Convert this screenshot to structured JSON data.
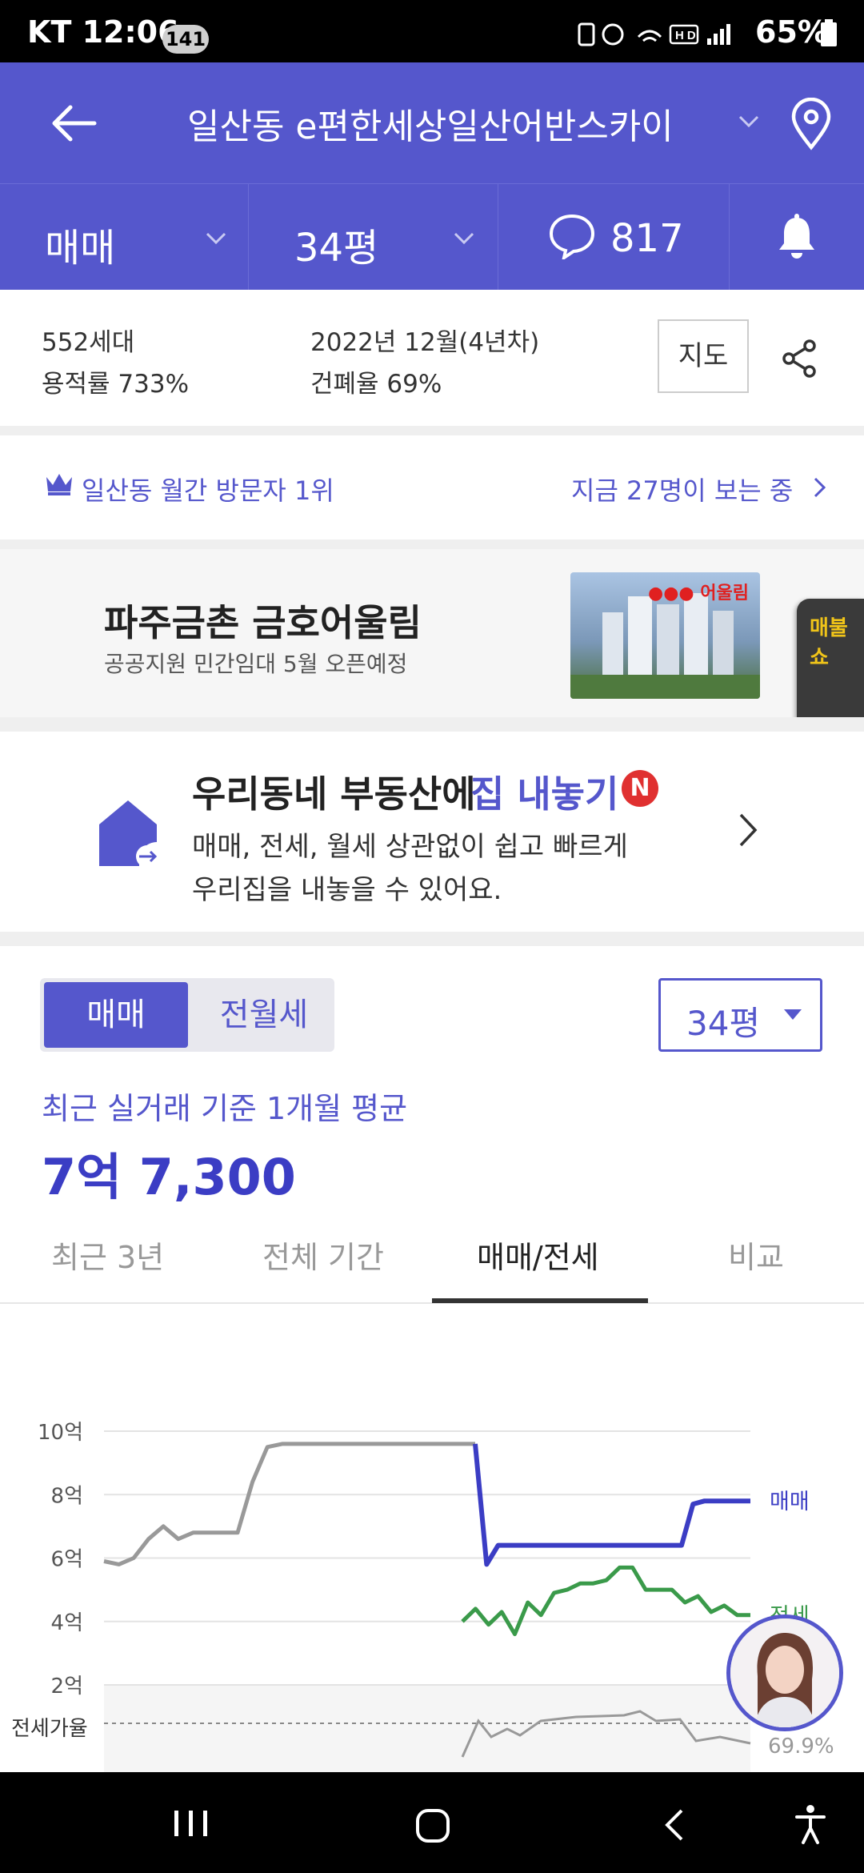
{
  "status": {
    "carrier": "KT",
    "time": "12:06",
    "notif_count": "141",
    "battery": "65%",
    "net_icons": "HD"
  },
  "header": {
    "title": "일산동 e편한세상일산어반스카이"
  },
  "subheader": {
    "trade_type": "매매",
    "size": "34평",
    "comment_count": "817"
  },
  "info": {
    "households": "552세대",
    "far": "용적률 733%",
    "built": "2022년 12월(4년차)",
    "bcr": "건폐율 69%",
    "map_button": "지도"
  },
  "rank": {
    "label": "일산동 월간 방문자 1위",
    "viewers": "지금 27명이 보는 중"
  },
  "ad": {
    "title": "파주금촌 금호어울림",
    "subtitle": "공공지원 민간임대 5월 오픈예정",
    "brand": "어울림",
    "side_banner": "매불쇼"
  },
  "promo": {
    "title_a": "우리동네 부동산에",
    "title_b": "집 내놓기",
    "badge": "N",
    "desc1": "매매, 전세, 월세 상관없이 쉽고 빠르게",
    "desc2": "우리집을 내놓을 수 있어요."
  },
  "toggle": {
    "on": "매매",
    "off": "전월세"
  },
  "size_select": {
    "value": "34평"
  },
  "avg": {
    "caption": "최근 실거래 기준 1개월 평균",
    "price": "7억 7,300"
  },
  "tabs": [
    "최근 3년",
    "전체 기간",
    "매매/전세",
    "비교"
  ],
  "colors": {
    "primary": "#5557cc",
    "sale": "#3b3dc4",
    "jeonse": "#3a9a4a",
    "history": "#999999"
  },
  "chart_data": {
    "type": "line",
    "y_ticks": [
      "10억",
      "8억",
      "6억",
      "4억",
      "2억"
    ],
    "ylim": [
      2,
      10
    ],
    "ratio_label": "전세가율",
    "ratio_value": "69.9%",
    "series": [
      {
        "name": "",
        "values": [
          5.9,
          5.8,
          6.0,
          6.6,
          7.0,
          6.6,
          6.8,
          6.8,
          6.8,
          6.8,
          8.4,
          9.5,
          9.6,
          9.6,
          9.6,
          9.6,
          9.6,
          9.6,
          9.6,
          9.6,
          9.6,
          9.6,
          9.6,
          9.6,
          9.6,
          9.6
        ]
      },
      {
        "name": "매매",
        "values": [
          9.6,
          5.8,
          6.4,
          6.4,
          6.4,
          6.4,
          6.4,
          6.4,
          6.4,
          6.4,
          6.4,
          6.4,
          6.4,
          6.4,
          6.4,
          6.4,
          6.4,
          6.4,
          6.4,
          7.7,
          7.8,
          7.8,
          7.8,
          7.8,
          7.8
        ]
      },
      {
        "name": "전세",
        "values": [
          4.0,
          4.4,
          3.9,
          4.3,
          3.6,
          4.6,
          4.2,
          4.9,
          5.0,
          5.2,
          5.2,
          5.3,
          5.7,
          5.7,
          5.0,
          5.0,
          5.0,
          4.6,
          4.8,
          4.3,
          4.5,
          4.2,
          4.2
        ]
      }
    ]
  },
  "navbar": {
    "recents": "|||",
    "home": "○",
    "back": "<"
  }
}
